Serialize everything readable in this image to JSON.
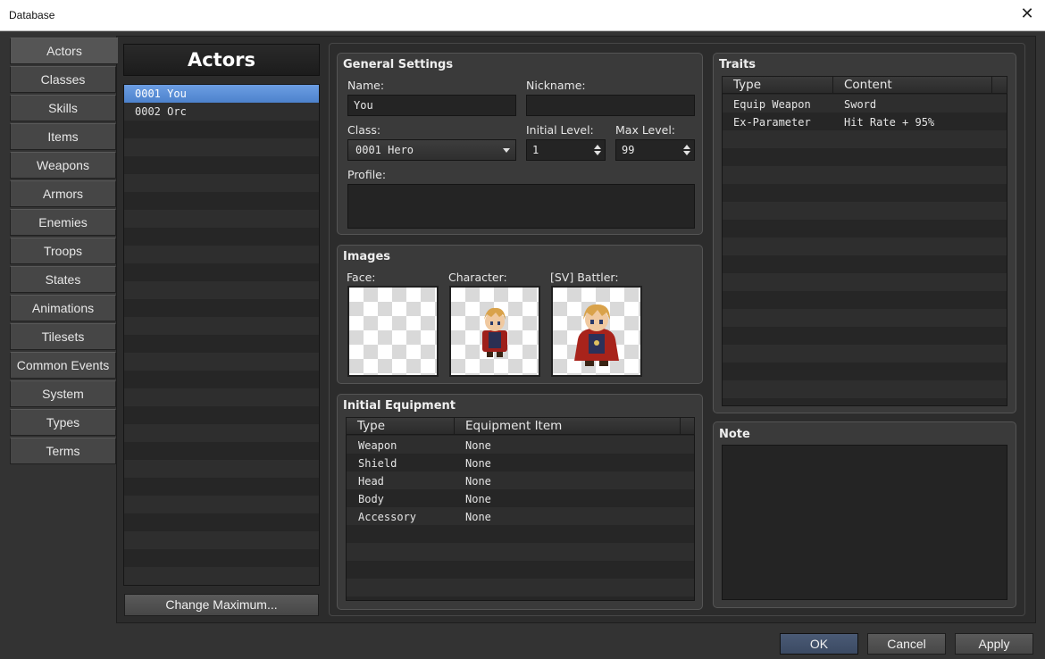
{
  "window": {
    "title": "Database",
    "close_glyph": "✕"
  },
  "categories": [
    "Actors",
    "Classes",
    "Skills",
    "Items",
    "Weapons",
    "Armors",
    "Enemies",
    "Troops",
    "States",
    "Animations",
    "Tilesets",
    "Common Events",
    "System",
    "Types",
    "Terms"
  ],
  "active_category": "Actors",
  "actor_list": {
    "header": "Actors",
    "items": [
      "0001 You",
      "0002 Orc"
    ],
    "selected_index": 0,
    "change_max_label": "Change Maximum..."
  },
  "general": {
    "title": "General Settings",
    "name_label": "Name:",
    "name_value": "You",
    "nickname_label": "Nickname:",
    "nickname_value": "",
    "class_label": "Class:",
    "class_value": "0001 Hero",
    "initial_level_label": "Initial Level:",
    "initial_level_value": "1",
    "max_level_label": "Max Level:",
    "max_level_value": "99",
    "profile_label": "Profile:",
    "profile_value": ""
  },
  "images": {
    "title": "Images",
    "face_label": "Face:",
    "character_label": "Character:",
    "battler_label": "[SV] Battler:"
  },
  "equipment": {
    "title": "Initial Equipment",
    "columns": [
      "Type",
      "Equipment Item"
    ],
    "rows": [
      [
        "Weapon",
        "None"
      ],
      [
        "Shield",
        "None"
      ],
      [
        "Head",
        "None"
      ],
      [
        "Body",
        "None"
      ],
      [
        "Accessory",
        "None"
      ]
    ]
  },
  "traits": {
    "title": "Traits",
    "columns": [
      "Type",
      "Content"
    ],
    "rows": [
      [
        "Equip Weapon",
        "Sword"
      ],
      [
        "Ex-Parameter",
        "Hit Rate + 95%"
      ]
    ]
  },
  "note": {
    "title": "Note",
    "value": ""
  },
  "footer": {
    "ok": "OK",
    "cancel": "Cancel",
    "apply": "Apply"
  }
}
